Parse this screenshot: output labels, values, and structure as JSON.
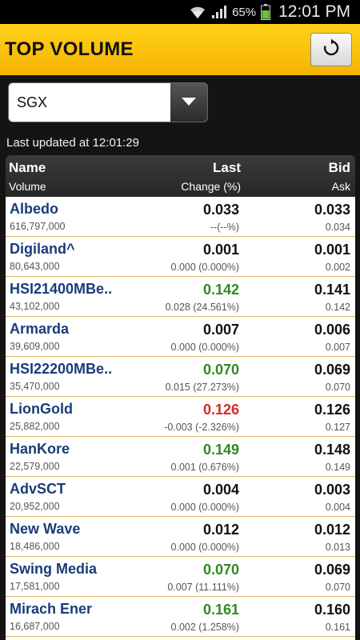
{
  "status_bar": {
    "battery_percent": "65%",
    "time": "12:01 PM"
  },
  "header": {
    "title": "TOP VOLUME",
    "refresh_icon": "refresh-icon"
  },
  "exchange": {
    "selected": "SGX"
  },
  "last_updated": "Last updated at 12:01:29",
  "columns": {
    "name": "Name",
    "last": "Last",
    "bid": "Bid",
    "volume": "Volume",
    "change": "Change (%)",
    "ask": "Ask"
  },
  "colors": {
    "up": "#2e8b1e",
    "down": "#d42a2a",
    "flat": "#111111",
    "name": "#1a3c78",
    "header_yellow": "#ffcc00"
  },
  "rows": [
    {
      "name": "Albedo",
      "volume": "616,797,000",
      "last": "0.033",
      "change": "--(--%)",
      "bid": "0.033",
      "ask": "0.034",
      "trend": "flat"
    },
    {
      "name": "Digiland^",
      "volume": "80,643,000",
      "last": "0.001",
      "change": "0.000 (0.000%)",
      "bid": "0.001",
      "ask": "0.002",
      "trend": "flat"
    },
    {
      "name": "HSI21400MBe..",
      "volume": "43,102,000",
      "last": "0.142",
      "change": "0.028 (24.561%)",
      "bid": "0.141",
      "ask": "0.142",
      "trend": "up"
    },
    {
      "name": "Armarda",
      "volume": "39,609,000",
      "last": "0.007",
      "change": "0.000 (0.000%)",
      "bid": "0.006",
      "ask": "0.007",
      "trend": "flat"
    },
    {
      "name": "HSI22200MBe..",
      "volume": "35,470,000",
      "last": "0.070",
      "change": "0.015 (27.273%)",
      "bid": "0.069",
      "ask": "0.070",
      "trend": "up"
    },
    {
      "name": "LionGold",
      "volume": "25,882,000",
      "last": "0.126",
      "change": "-0.003 (-2.326%)",
      "bid": "0.126",
      "ask": "0.127",
      "trend": "down"
    },
    {
      "name": "HanKore",
      "volume": "22,579,000",
      "last": "0.149",
      "change": "0.001 (0.676%)",
      "bid": "0.148",
      "ask": "0.149",
      "trend": "up"
    },
    {
      "name": "AdvSCT",
      "volume": "20,952,000",
      "last": "0.004",
      "change": "0.000 (0.000%)",
      "bid": "0.003",
      "ask": "0.004",
      "trend": "flat"
    },
    {
      "name": "New Wave",
      "volume": "18,486,000",
      "last": "0.012",
      "change": "0.000 (0.000%)",
      "bid": "0.012",
      "ask": "0.013",
      "trend": "flat"
    },
    {
      "name": "Swing Media",
      "volume": "17,581,000",
      "last": "0.070",
      "change": "0.007 (11.111%)",
      "bid": "0.069",
      "ask": "0.070",
      "trend": "up"
    },
    {
      "name": "Mirach Ener",
      "volume": "16,687,000",
      "last": "0.161",
      "change": "0.002 (1.258%)",
      "bid": "0.160",
      "ask": "0.161",
      "trend": "up"
    }
  ]
}
